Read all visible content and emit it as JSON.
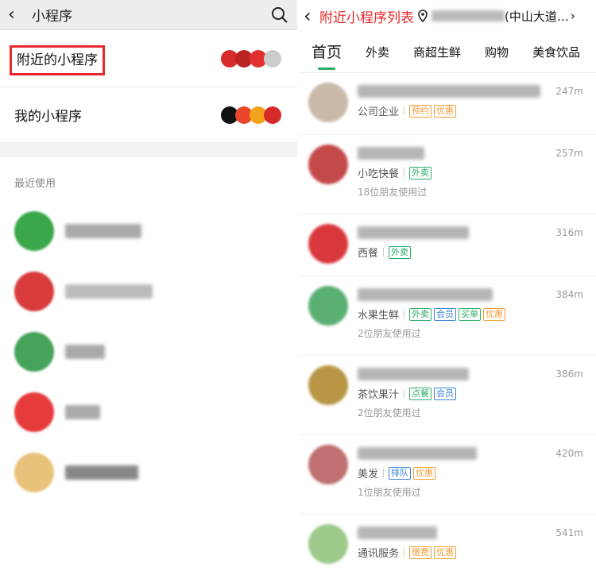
{
  "left": {
    "header": {
      "title": "小程序"
    },
    "rows": [
      {
        "label": "附近的小程序",
        "highlight": true
      },
      {
        "label": "我的小程序",
        "highlight": false
      }
    ],
    "recent_label": "最近使用",
    "recent_apps": [
      {
        "icon_color": "#3aa84a",
        "name_color": "#aaa"
      },
      {
        "icon_color": "#d83b3b",
        "name_color": "#bbb"
      },
      {
        "icon_color": "#46a35a",
        "name_color": "#aaa"
      },
      {
        "icon_color": "#e63b3b",
        "name_color": "#aaa"
      },
      {
        "icon_color": "#e8c27a",
        "name_color": "#888"
      }
    ]
  },
  "right": {
    "header": {
      "title": "附近小程序列表",
      "location": "(中山大道…"
    },
    "tabs": [
      "首页",
      "外卖",
      "商超生鲜",
      "购物",
      "美食饮品"
    ],
    "shops": [
      {
        "dist": "247m",
        "category": "公司企业",
        "tags": [
          [
            "预约",
            "o"
          ],
          [
            "优惠",
            "o"
          ]
        ],
        "friends": "",
        "icon_color": "#c9b9a8"
      },
      {
        "dist": "257m",
        "category": "小吃快餐",
        "tags": [
          [
            "外卖",
            "g"
          ]
        ],
        "friends": "18位朋友使用过",
        "icon_color": "#c44a4a"
      },
      {
        "dist": "316m",
        "category": "西餐",
        "tags": [
          [
            "外卖",
            "g"
          ]
        ],
        "friends": "",
        "icon_color": "#d8383c"
      },
      {
        "dist": "384m",
        "category": "水果生鲜",
        "tags": [
          [
            "外卖",
            "g"
          ],
          [
            "会员",
            "b"
          ],
          [
            "买单",
            "g"
          ],
          [
            "优惠",
            "o"
          ]
        ],
        "friends": "2位朋友使用过",
        "icon_color": "#5aaf73"
      },
      {
        "dist": "386m",
        "category": "茶饮果汁",
        "tags": [
          [
            "点餐",
            "g"
          ],
          [
            "会员",
            "b"
          ]
        ],
        "friends": "2位朋友使用过",
        "icon_color": "#b89646"
      },
      {
        "dist": "420m",
        "category": "美发",
        "tags": [
          [
            "排队",
            "b"
          ],
          [
            "优惠",
            "o"
          ]
        ],
        "friends": "1位朋友使用过",
        "icon_color": "#c07070"
      },
      {
        "dist": "541m",
        "category": "通讯服务",
        "tags": [
          [
            "缴费",
            "o"
          ],
          [
            "优惠",
            "o"
          ]
        ],
        "friends": "",
        "icon_color": "#9dc98a"
      }
    ]
  },
  "colors": {
    "accent_red": "#e6282c",
    "accent_green": "#2aae67"
  }
}
